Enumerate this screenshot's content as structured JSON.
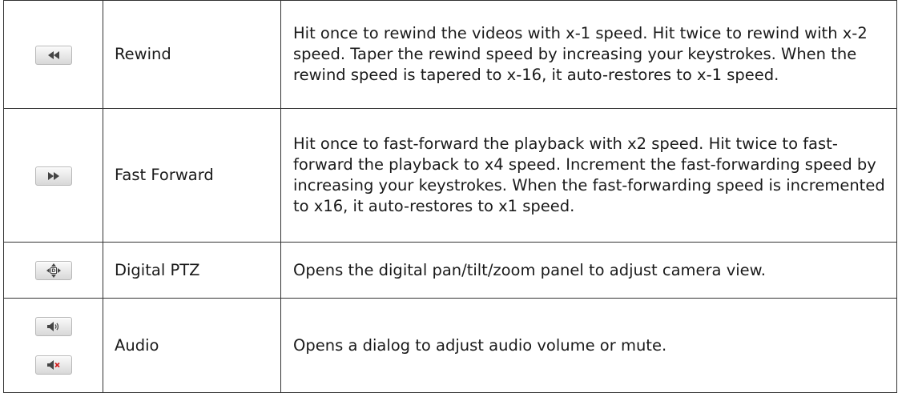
{
  "rows": [
    {
      "name": "Rewind",
      "icon": "rewind-icon",
      "description": "Hit once to rewind the videos with x-1 speed. Hit twice to rewind with x-2 speed. Taper the rewind speed by increasing your keystrokes. When the rewind speed is tapered to x-16, it auto-restores to x-1 speed."
    },
    {
      "name": "Fast Forward",
      "icon": "fast-forward-icon",
      "description": "Hit once to fast-forward the playback with x2 speed. Hit twice to fast-forward the playback to x4 speed. Increment the fast-forwarding speed by increasing your keystrokes. When the fast-forwarding speed is incremented to x16, it auto-restores to x1 speed."
    },
    {
      "name": "Digital PTZ",
      "icon": "digital-ptz-icon",
      "description": "Opens the digital pan/tilt/zoom panel to adjust camera view."
    },
    {
      "name": "Audio",
      "icons": [
        "audio-on-icon",
        "audio-mute-icon"
      ],
      "description": "Opens a dialog to adjust audio volume or mute."
    }
  ],
  "colors": {
    "border": "#333333",
    "button_border": "#b8b8b8",
    "icon_dark": "#444444",
    "mute_red": "#d11f1f"
  }
}
